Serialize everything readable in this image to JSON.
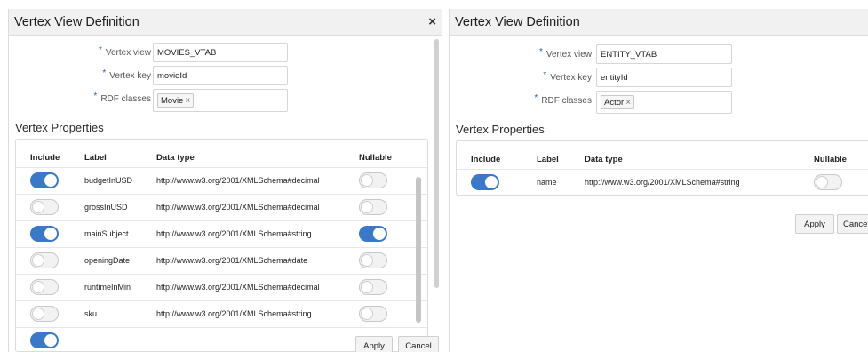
{
  "left_panel": {
    "title": "Vertex View Definition",
    "close_icon": "close-icon",
    "vertex_view": {
      "label": "Vertex view",
      "value": "MOVIES_VTAB"
    },
    "vertex_key": {
      "label": "Vertex key",
      "value": "movieId"
    },
    "rdf_classes": {
      "label": "RDF classes",
      "chip": "Movie",
      "chip_remove": "×"
    },
    "section_title": "Vertex Properties",
    "columns": {
      "include": "Include",
      "label": "Label",
      "data_type": "Data type",
      "nullable": "Nullable"
    },
    "rows": [
      {
        "include": true,
        "label": "budgetInUSD",
        "data_type": "http://www.w3.org/2001/XMLSchema#decimal",
        "nullable": false
      },
      {
        "include": false,
        "label": "grossInUSD",
        "data_type": "http://www.w3.org/2001/XMLSchema#decimal",
        "nullable": false
      },
      {
        "include": true,
        "label": "mainSubject",
        "data_type": "http://www.w3.org/2001/XMLSchema#string",
        "nullable": true
      },
      {
        "include": false,
        "label": "openingDate",
        "data_type": "http://www.w3.org/2001/XMLSchema#date",
        "nullable": false
      },
      {
        "include": false,
        "label": "runtimeInMin",
        "data_type": "http://www.w3.org/2001/XMLSchema#decimal",
        "nullable": false
      },
      {
        "include": false,
        "label": "sku",
        "data_type": "http://www.w3.org/2001/XMLSchema#string",
        "nullable": false
      }
    ],
    "apply": "Apply",
    "cancel": "Cancel"
  },
  "right_panel": {
    "title": "Vertex View Definition",
    "vertex_view": {
      "label": "Vertex view",
      "value": "ENTITY_VTAB"
    },
    "vertex_key": {
      "label": "Vertex key",
      "value": "entityId"
    },
    "rdf_classes": {
      "label": "RDF classes",
      "chip": "Actor",
      "chip_remove": "×"
    },
    "section_title": "Vertex Properties",
    "columns": {
      "include": "Include",
      "label": "Label",
      "data_type": "Data type",
      "nullable": "Nullable"
    },
    "rows": [
      {
        "include": true,
        "label": "name",
        "data_type": "http://www.w3.org/2001/XMLSchema#string",
        "nullable": false
      }
    ],
    "apply": "Apply",
    "cancel": "Cance"
  },
  "required_marker": "*",
  "colors": {
    "toggle_on": "#3b78c8",
    "required": "#2a64b8",
    "titlebar": "#f1f1f1"
  }
}
